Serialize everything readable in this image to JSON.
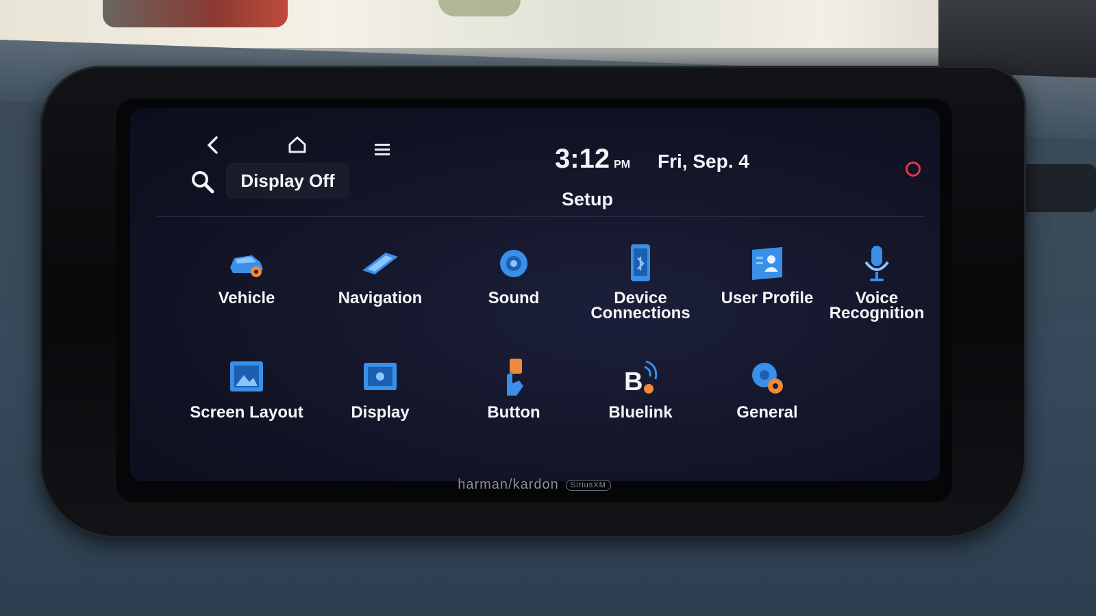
{
  "status_bar": {
    "time": "3:12",
    "ampm": "PM",
    "date": "Fri, Sep. 4",
    "title": "Setup",
    "display_off_label": "Display Off"
  },
  "icons": {
    "back": "back-arrow-icon",
    "home": "home-icon",
    "menu": "menu-icon",
    "search": "search-icon"
  },
  "settings": [
    {
      "label": "Vehicle",
      "icon": "vehicle-icon"
    },
    {
      "label": "Navigation",
      "icon": "navigation-icon"
    },
    {
      "label": "Sound",
      "icon": "sound-icon"
    },
    {
      "label": "Device\nConnections",
      "icon": "device-connections-icon"
    },
    {
      "label": "User Profile",
      "icon": "user-profile-icon"
    },
    {
      "label": "Voice Recognition",
      "icon": "voice-recognition-icon"
    },
    {
      "label": "Screen Layout",
      "icon": "screen-layout-icon"
    },
    {
      "label": "Display",
      "icon": "display-icon"
    },
    {
      "label": "Button",
      "icon": "button-icon"
    },
    {
      "label": "Bluelink",
      "icon": "bluelink-icon"
    },
    {
      "label": "General",
      "icon": "general-icon"
    }
  ],
  "brand": {
    "name": "harman/kardon",
    "sub": "SiriusXM"
  },
  "colors": {
    "icon_blue": "#3a8fe8",
    "icon_orange": "#f08a3a",
    "screen_bg": "#14162a"
  }
}
